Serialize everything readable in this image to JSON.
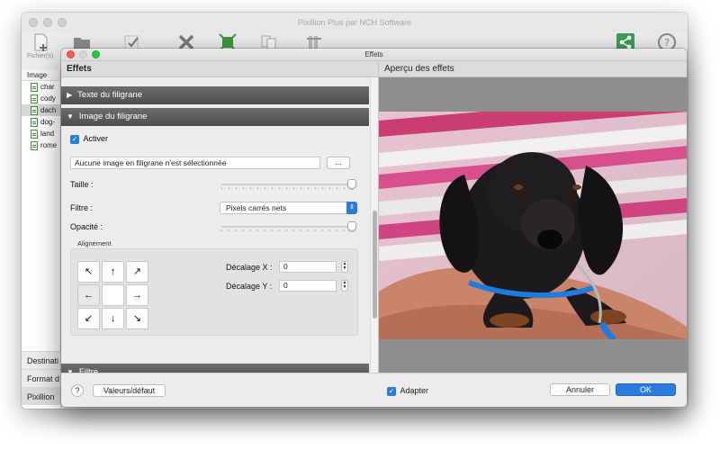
{
  "main_window": {
    "title": "Pixillion Plus par NCH Software",
    "toolbar": {
      "fichiers_label": "Fichier(s)"
    },
    "file_list": {
      "header": "Image",
      "items": [
        "char",
        "cody",
        "dach",
        "dog-",
        "land",
        "rome"
      ],
      "selected_index": 2
    },
    "lower_rows": [
      "Destinati",
      "Format d",
      "Pixillion P"
    ]
  },
  "dialog": {
    "title": "Effets",
    "effects_header": "Effets",
    "preview_header": "Aperçu des effets",
    "sections": {
      "texte": "Texte du filigrane",
      "image": "Image du filigrane",
      "filtre": "Filtre"
    },
    "activer_label": "Activer",
    "activer_checked": true,
    "watermark_field": "Aucune image en filigrane n'est sélectionnée",
    "browse_button": "...",
    "taille_label": "Taille :",
    "taille_value": 1.0,
    "filtre_label": "Filtre :",
    "filtre_value": "Pixels carrés nets",
    "opacite_label": "Opacité :",
    "opacite_value": 1.0,
    "alignement_label": "Alignement",
    "align_buttons": [
      "↖",
      "↑",
      "↗",
      "←",
      "",
      "→",
      "↙",
      "↓",
      "↘"
    ],
    "align_active_index": 3,
    "offset_x_label": "Décalage X :",
    "offset_x_value": "0",
    "offset_y_label": "Décalage Y :",
    "offset_y_value": "0",
    "help_button": "?",
    "defaults_button": "Valeurs/défaut",
    "adapter_label": "Adapter",
    "adapter_checked": true,
    "cancel_button": "Annuler",
    "ok_button": "OK"
  },
  "colors": {
    "accent": "#2b7cde",
    "section_bar": "#5a5a5a",
    "preview_bg": "#8e8e8e"
  }
}
